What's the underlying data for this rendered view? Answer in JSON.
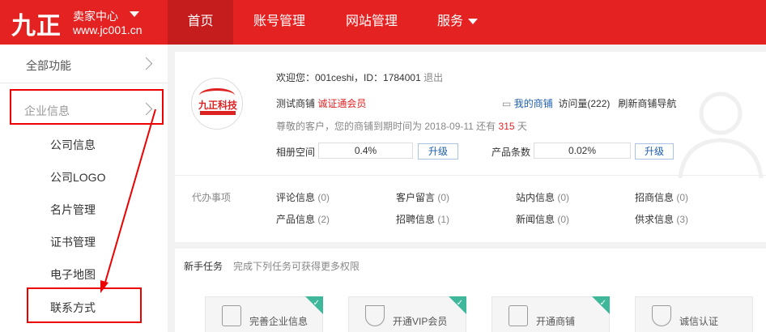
{
  "header": {
    "logo_text": "九正",
    "center_title": "卖家中心",
    "domain": "www.jc001.cn",
    "nav": [
      "首页",
      "账号管理",
      "网站管理",
      "服务"
    ]
  },
  "sidebar": {
    "all_label": "全部功能",
    "section_label": "企业信息",
    "items": [
      "公司信息",
      "公司LOGO",
      "名片管理",
      "证书管理",
      "电子地图",
      "联系方式"
    ]
  },
  "profile": {
    "logo_text": "九正科技",
    "welcome": "欢迎您：001ceshi，ID：1784001",
    "logout": "退出",
    "shop_name": "测试商铺",
    "member_type": "诚证通会员",
    "my_shop": "我的商铺",
    "visits": "访问量(222)",
    "refresh_nav": "刷新商铺导航",
    "expiry_prefix": "尊敬的客户，您的商铺到期时间为 2018-09-11 还有",
    "expiry_days": "315",
    "expiry_suffix": "天",
    "album_label": "相册空间",
    "album_usage": "0.4%",
    "product_label": "产品条数",
    "product_usage": "0.02%",
    "upgrade": "升级"
  },
  "todos": {
    "title": "代办事项",
    "items": [
      {
        "label": "评论信息",
        "count": "(0)"
      },
      {
        "label": "客户留言",
        "count": "(0)"
      },
      {
        "label": "站内信息",
        "count": "(0)"
      },
      {
        "label": "招商信息",
        "count": "(0)"
      },
      {
        "label": "产品信息",
        "count": "(2)"
      },
      {
        "label": "招聘信息",
        "count": "(1)"
      },
      {
        "label": "新闻信息",
        "count": "(0)"
      },
      {
        "label": "供求信息",
        "count": "(3)"
      }
    ]
  },
  "tasks": {
    "title": "新手任务",
    "subtitle": "完成下列任务可获得更多权限",
    "cards": [
      "完善企业信息",
      "开通VIP会员",
      "开通商铺",
      "诚信认证"
    ]
  },
  "colors": {
    "brand_red": "#e42222",
    "nav_active": "#c51d1d",
    "highlight_red": "#ee0000",
    "done_green": "#3fb79a"
  }
}
